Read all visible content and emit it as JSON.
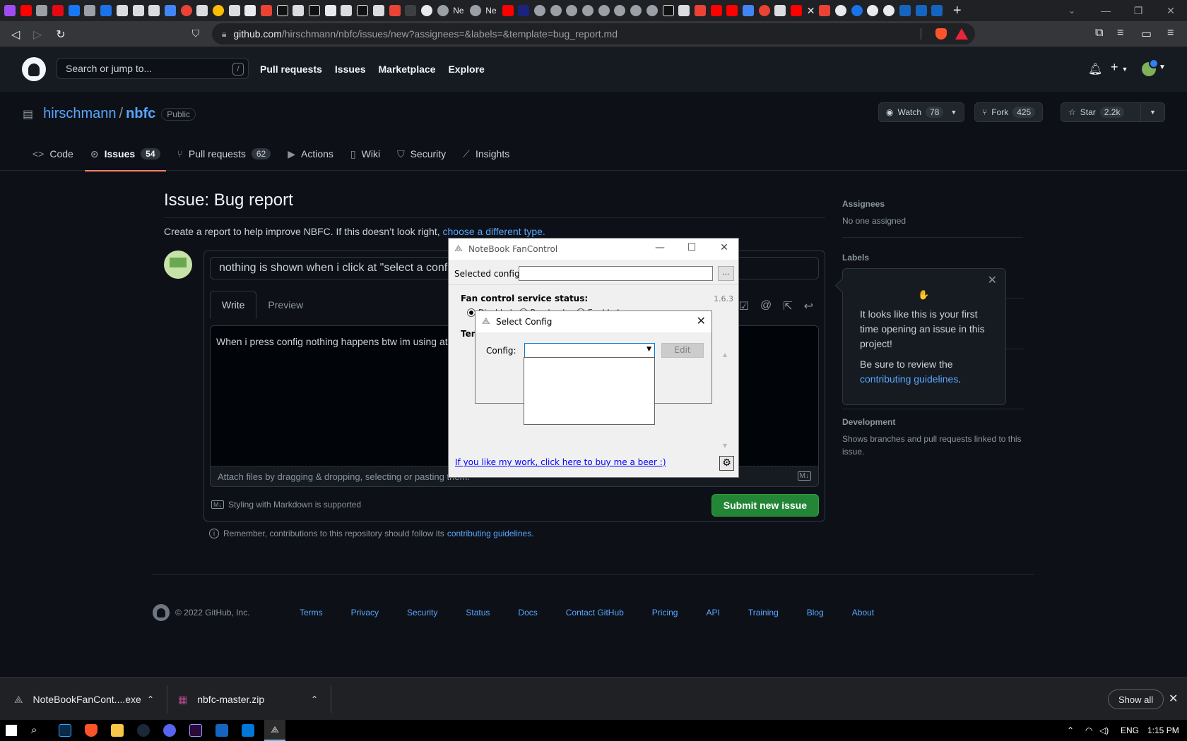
{
  "browser": {
    "url_host": "github.com",
    "url_path": "/hirschmann/nbfc/issues/new?assignees=&labels=&template=bug_report.md",
    "tab_labels": [
      "Ne",
      "Ne"
    ],
    "new_tab": "+"
  },
  "github": {
    "search_placeholder": "Search or jump to...",
    "search_shortcut": "/",
    "nav": [
      "Pull requests",
      "Issues",
      "Marketplace",
      "Explore"
    ],
    "repo_owner": "hirschmann",
    "repo_sep": "/",
    "repo_name": "nbfc",
    "visibility": "Public",
    "watch_label": "Watch",
    "watch_count": "78",
    "fork_label": "Fork",
    "fork_count": "425",
    "star_label": "Star",
    "star_count": "2.2k",
    "tabs": [
      {
        "label": "Code",
        "icon": "code-icon"
      },
      {
        "label": "Issues",
        "count": "54",
        "icon": "issue-opened-icon"
      },
      {
        "label": "Pull requests",
        "count": "62",
        "icon": "git-pull-request-icon"
      },
      {
        "label": "Actions",
        "icon": "play-icon"
      },
      {
        "label": "Wiki",
        "icon": "book-icon"
      },
      {
        "label": "Security",
        "icon": "shield-icon"
      },
      {
        "label": "Insights",
        "icon": "graph-icon"
      }
    ]
  },
  "issue": {
    "heading": "Issue: Bug report",
    "intro_text": "Create a report to help improve NBFC. If this doesn’t look right,",
    "intro_link": "choose a different type.",
    "title_value": "nothing is shown when i click at \"select a config",
    "write_tab": "Write",
    "preview_tab": "Preview",
    "body_value": "When i press config nothing happens btw im using at",
    "attach_hint": "Attach files by dragging & dropping, selecting or pasting them.",
    "md_note": "Styling with Markdown is supported",
    "submit_label": "Submit new issue",
    "remember_text": "Remember, contributions to this repository should follow its",
    "remember_link": "contributing guidelines."
  },
  "sidebar": {
    "assignees_heading": "Assignees",
    "assignees_value": "No one assigned",
    "labels_heading": "Labels",
    "development_heading": "Development",
    "development_text": "Shows branches and pull requests linked to this issue."
  },
  "popover": {
    "line1": "It looks like this is your first time opening an issue in this project!",
    "line2": "Be sure to review the",
    "link": "contributing guidelines",
    "tail": "."
  },
  "footer": {
    "copyright": "© 2022 GitHub, Inc.",
    "links": [
      "Terms",
      "Privacy",
      "Security",
      "Status",
      "Docs",
      "Contact GitHub",
      "Pricing",
      "API",
      "Training",
      "Blog",
      "About"
    ]
  },
  "nbfc": {
    "window_title": "NoteBook FanControl",
    "selected_config_label": "Selected config:",
    "browse_label": "...",
    "status_label": "Fan control service status:",
    "version": "1.6.3",
    "radio_labels": [
      "Disabled",
      "Read-only",
      "Enabled"
    ],
    "temp_label": "Tem",
    "donate_link": "If you like my work, click here to buy me a beer :)"
  },
  "select_config": {
    "title": "Select Config",
    "config_label": "Config:",
    "edit_label": "Edit"
  },
  "downloads": {
    "item1": "NoteBookFanCont....exe",
    "item2": "nbfc-master.zip",
    "show_all": "Show all"
  },
  "taskbar": {
    "language": "ENG",
    "time": "1:15 PM"
  },
  "colors": {
    "accent": "#58a6ff",
    "submit_green": "#238636",
    "tab_underline": "#f78166",
    "background": "#0d1117"
  }
}
